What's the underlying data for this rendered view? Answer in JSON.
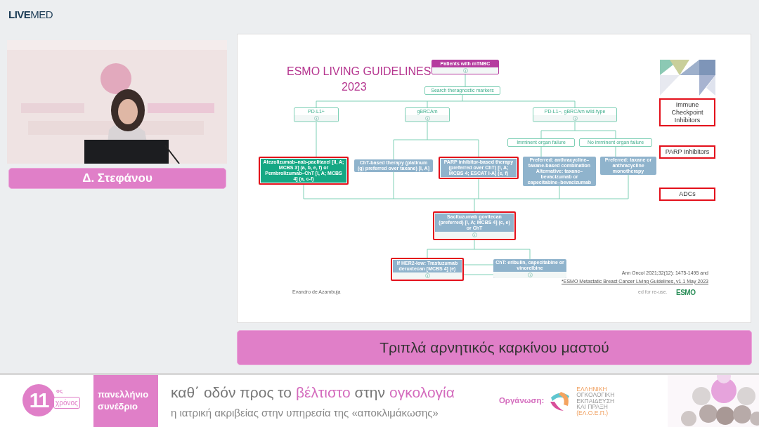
{
  "brand": {
    "strong": "LIVE",
    "light": "MED"
  },
  "speaker": {
    "kind": "picture",
    "name": "Δ. Στεφάνου"
  },
  "slide": {
    "title": [
      "ESMO LIVING GUIDELINES",
      "2023"
    ],
    "nodes": [
      {
        "kind": "start",
        "text": "Patients with mTNBC",
        "info": true,
        "highlighted": false
      },
      {
        "kind": "outline",
        "text": "Search theragnostic markers",
        "info": false,
        "highlighted": false
      },
      {
        "kind": "outline",
        "text": "PD-L1+",
        "info": true,
        "highlighted": false
      },
      {
        "kind": "outline",
        "text": "gBRCAm",
        "info": true,
        "highlighted": false
      },
      {
        "kind": "outline",
        "text": "PD-L1−, gBRCAm wild-type",
        "info": true,
        "highlighted": false
      },
      {
        "kind": "outline",
        "text": "Imminent organ failure",
        "info": false,
        "highlighted": false
      },
      {
        "kind": "outline",
        "text": "No imminent organ failure",
        "info": false,
        "highlighted": false
      },
      {
        "kind": "green",
        "text": "Atezolizumab–nab-paclitaxel [II, A; MCBS 3] (a, b, e, f) or Pembrolizumab–ChT [I, A; MCBS 4] (a, c-f)",
        "info": false,
        "highlighted": true
      },
      {
        "kind": "blue",
        "text": "ChT-based therapy (platinum (g) preferred over taxane) [I, A]",
        "info": false,
        "highlighted": false
      },
      {
        "kind": "blue",
        "text": "PARP inhibitor-based therapy (preferred over ChT) [I, A; MCBS 4; ESCAT I-A] (e, f)",
        "info": false,
        "highlighted": true
      },
      {
        "kind": "blue",
        "text": "Preferred: anthracycline–taxane-based combination Alternative: taxane–bevacizumab or capecitabine–bevacizumab",
        "info": false,
        "highlighted": false
      },
      {
        "kind": "blue",
        "text": "Preferred: taxane or anthracycline monotherapy",
        "info": false,
        "highlighted": false
      },
      {
        "kind": "blue",
        "text": "Sacituzumab govitecan (preferred) [I, A; MCBS 4] (c, e) or ChT",
        "info": true,
        "highlighted": true
      },
      {
        "kind": "blue",
        "text": "If HER2-low: Trastuzumab deruxtecan [MCBS 4] (e)",
        "info": true,
        "highlighted": true
      },
      {
        "kind": "blue",
        "text": "ChT: eribulin, capecitabine or vinorelbine",
        "info": true,
        "highlighted": false
      }
    ],
    "side_labels": [
      "Immune Checkpoint Inhibitors",
      "PARP Inhibitors",
      "ADCs"
    ],
    "author": "Evandro de Azambuja",
    "citation": [
      "Ann Oncol 2021;32(12): 1475-1495 and",
      "*ESMO Metastatic Breast Cancer Living Guidelines, v1.1 May 2023"
    ],
    "reuse_note": "ed for re-use.",
    "logo_text": "ESMO"
  },
  "caption": "Τριπλά αρνητικός καρκίνου μαστού",
  "banner": {
    "badge": {
      "number": "11",
      "suffix": "ος",
      "label": "χρόνος"
    },
    "event": [
      "πανελλήνιο",
      "συνέδριο"
    ],
    "tagline": [
      {
        "text": "καθ΄ οδόν προς το",
        "accent": false
      },
      {
        "text": "βέλτιστο",
        "accent": true
      },
      {
        "text": "στην",
        "accent": false
      },
      {
        "text": "ογκολογία",
        "accent": true
      }
    ],
    "subtitle": "η ιατρική ακριβείας στην υπηρεσία της «αποκλιμάκωσης»",
    "organizer_label": "Οργάνωση:",
    "organizer": [
      {
        "text": "ΕΛΛΗΝΙΚΗ",
        "accent": true
      },
      {
        "text": "ΟΓΚΟΛΟΓΙΚΗ",
        "accent": false
      },
      {
        "text": "ΕΚΠΑΙΔΕΥΣΗ",
        "accent": false
      },
      {
        "text": "ΚΑΙ ΠΡΑΞΗ",
        "accent": false
      },
      {
        "text": "(ΕΛ.Ο.Ε.Π.)",
        "accent": true
      }
    ],
    "art": {
      "kind": "picture"
    }
  }
}
